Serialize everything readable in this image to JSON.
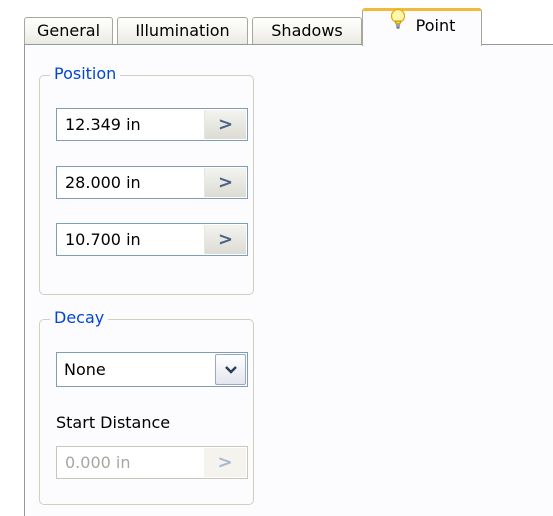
{
  "tabs": [
    {
      "label": "General"
    },
    {
      "label": "Illumination"
    },
    {
      "label": "Shadows"
    },
    {
      "label": "Point",
      "active": true,
      "icon": "lightbulb-icon"
    }
  ],
  "position": {
    "legend": "Position",
    "fields": [
      {
        "value": "12.349 in"
      },
      {
        "value": "28.000 in"
      },
      {
        "value": "10.700 in"
      }
    ]
  },
  "decay": {
    "legend": "Decay",
    "selected": "None",
    "start_distance_label": "Start Distance",
    "start_distance_value": "0.000 in",
    "start_distance_enabled": false
  },
  "icons": {
    "arrow": "chevron-right-icon",
    "dropdown": "chevron-down-icon",
    "tab_icon": "lightbulb-icon"
  },
  "colors": {
    "active_tab_accent": "#f3b93a",
    "group_legend": "#0046d5"
  }
}
